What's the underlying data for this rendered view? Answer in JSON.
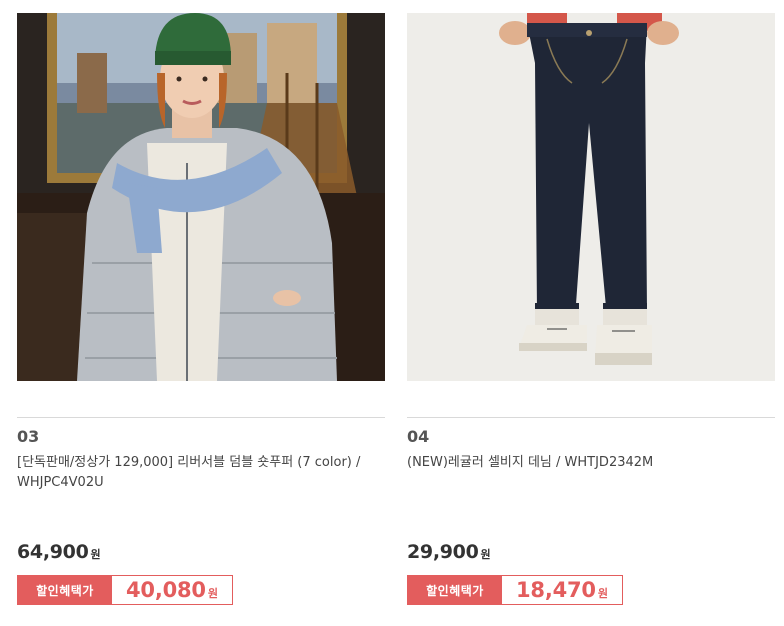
{
  "products": [
    {
      "rank": "03",
      "name": "[단독판매/정상가 129,000] 리버서블 덤블 숏푸퍼 (7 color) / WHJPC4V02U",
      "price": "64,900",
      "price_unit": "원",
      "discount_label": "할인혜택가",
      "discount_price": "40,080",
      "discount_unit": "원"
    },
    {
      "rank": "04",
      "name": "(NEW)레귤러 셀비지 데님 / WHTJD2342M",
      "price": "29,900",
      "price_unit": "원",
      "discount_label": "할인혜택가",
      "discount_price": "18,470",
      "discount_unit": "원"
    }
  ],
  "colors": {
    "accent": "#e35d5d",
    "price_text": "#333333",
    "divider": "#d9d9d9"
  }
}
